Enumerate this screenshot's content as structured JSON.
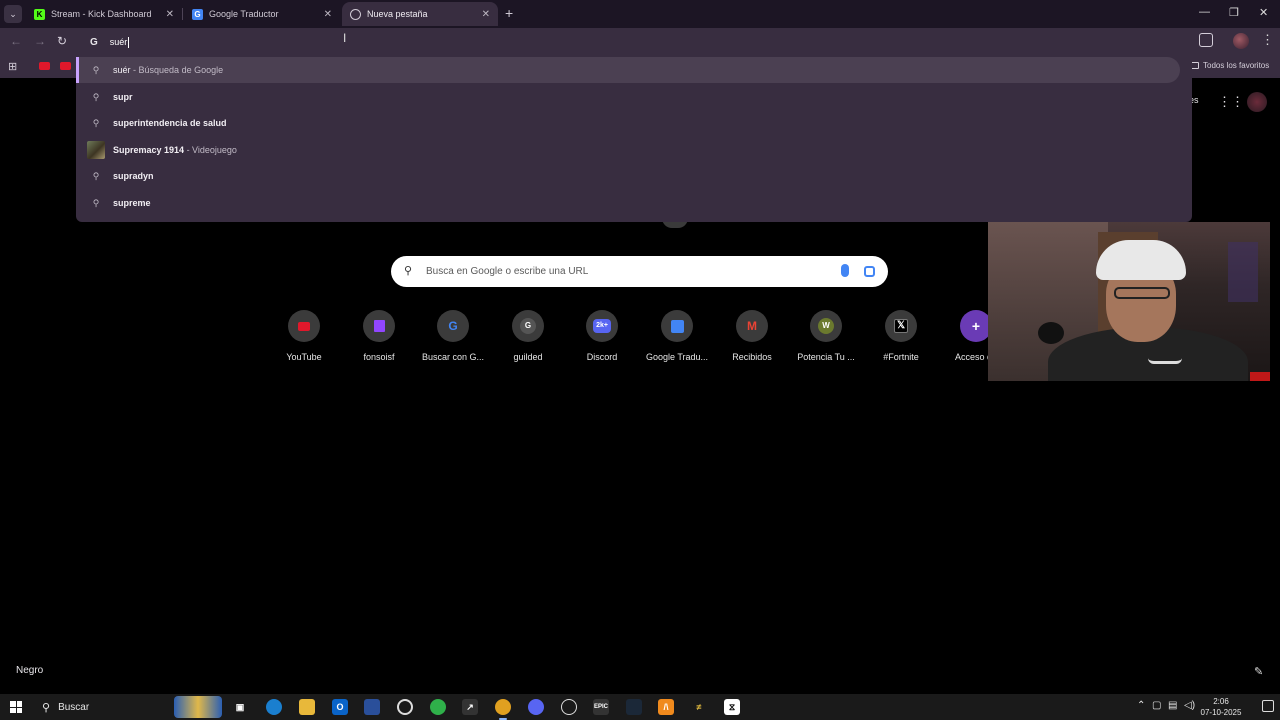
{
  "tabs": [
    {
      "title": "Stream - Kick Dashboard",
      "favicon": "kick-icon",
      "active": false
    },
    {
      "title": "Google Traductor",
      "favicon": "translate-icon",
      "active": false
    },
    {
      "title": "Nueva pestaña",
      "favicon": "chrome-icon",
      "active": true
    }
  ],
  "omnibox": {
    "query": "suér",
    "suggestions": [
      {
        "text": "suér",
        "suffix": "- Búsqueda de Google",
        "icon": "search-icon",
        "selected": true
      },
      {
        "text": "supr",
        "suffix": "",
        "icon": "search-icon"
      },
      {
        "text": "superintendencia de salud",
        "suffix": "",
        "icon": "search-icon"
      },
      {
        "text": "Supremacy 1914",
        "suffix": "- Videojuego",
        "icon": "game-thumbnail"
      },
      {
        "text": "supradyn",
        "suffix": "",
        "icon": "search-icon"
      },
      {
        "text": "supreme",
        "suffix": "",
        "icon": "search-icon"
      }
    ]
  },
  "bookmarks": {
    "all_label": "Todos los favoritos"
  },
  "ntp": {
    "peek_text": "es",
    "search_placeholder": "Busca en Google o escribe una URL",
    "shortcuts": [
      {
        "label": "YouTube",
        "icon": "youtube-icon",
        "color": "#e0182b"
      },
      {
        "label": "fonsoisf",
        "icon": "twitch-icon",
        "color": "#9146ff"
      },
      {
        "label": "Buscar con G...",
        "icon": "google-icon",
        "color": "#ffffff"
      },
      {
        "label": "guilded",
        "icon": "guilded-icon",
        "color": "#555555"
      },
      {
        "label": "Discord",
        "icon": "discord-icon",
        "color": "#5865f2"
      },
      {
        "label": "Google Tradu...",
        "icon": "translate-icon",
        "color": "#4285f4"
      },
      {
        "label": "Recibidos",
        "icon": "gmail-icon",
        "color": "#ea4335"
      },
      {
        "label": "Potencia Tu ...",
        "icon": "w-icon",
        "color": "#6b7a2e"
      },
      {
        "label": "#Fortnite",
        "icon": "x-icon",
        "color": "#000000"
      },
      {
        "label": "Acceso dir",
        "icon": "add-icon",
        "color": "#6a3bb5"
      }
    ],
    "theme_label": "Negro"
  },
  "taskbar": {
    "search_label": "Buscar",
    "time": "2:06",
    "date": "07-10-2025"
  }
}
